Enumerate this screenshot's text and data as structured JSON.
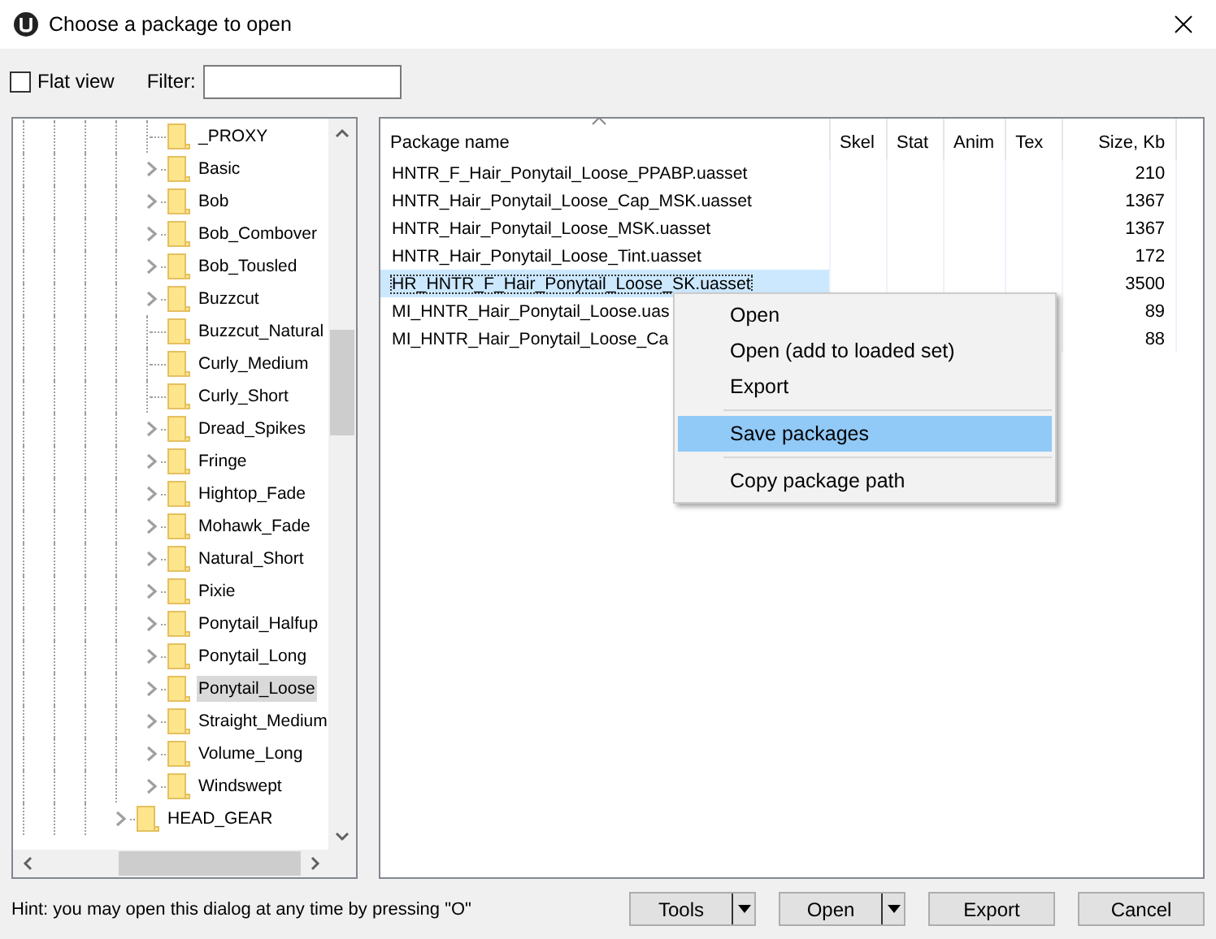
{
  "window": {
    "title": "Choose a package to open"
  },
  "toolbar": {
    "flat_view": {
      "label": "Flat view",
      "checked": false
    },
    "filter": {
      "label": "Filter:"
    }
  },
  "tree": {
    "items": [
      {
        "children": [
          {
            "label": "_PROXY",
            "expandable": false,
            "selected": false
          },
          {
            "label": "Basic",
            "expandable": true,
            "selected": false
          },
          {
            "label": "Bob",
            "expandable": true,
            "selected": false
          },
          {
            "label": "Bob_Combover",
            "expandable": true,
            "selected": false
          },
          {
            "label": "Bob_Tousled",
            "expandable": true,
            "selected": false
          },
          {
            "label": "Buzzcut",
            "expandable": true,
            "selected": false
          },
          {
            "label": "Buzzcut_Natural",
            "expandable": false,
            "selected": false
          },
          {
            "label": "Curly_Medium",
            "expandable": false,
            "selected": false
          },
          {
            "label": "Curly_Short",
            "expandable": false,
            "selected": false
          },
          {
            "label": "Dread_Spikes",
            "expandable": true,
            "selected": false
          },
          {
            "label": "Fringe",
            "expandable": true,
            "selected": false
          },
          {
            "label": "Hightop_Fade",
            "expandable": true,
            "selected": false
          },
          {
            "label": "Mohawk_Fade",
            "expandable": true,
            "selected": false
          },
          {
            "label": "Natural_Short",
            "expandable": true,
            "selected": false
          },
          {
            "label": "Pixie",
            "expandable": true,
            "selected": false
          },
          {
            "label": "Ponytail_Halfup",
            "expandable": true,
            "selected": false
          },
          {
            "label": "Ponytail_Long",
            "expandable": true,
            "selected": false
          },
          {
            "label": "Ponytail_Loose",
            "expandable": true,
            "selected": true
          },
          {
            "label": "Straight_Medium",
            "expandable": true,
            "selected": false
          },
          {
            "label": "Volume_Long",
            "expandable": true,
            "selected": false
          },
          {
            "label": "Windswept",
            "expandable": true,
            "selected": false
          }
        ]
      },
      {
        "label": "HEAD_GEAR",
        "expandable": true,
        "selected": false
      }
    ]
  },
  "list": {
    "columns": [
      {
        "label": "Package name",
        "sorted": true
      },
      {
        "label": "Skel",
        "sorted": false
      },
      {
        "label": "Stat",
        "sorted": false
      },
      {
        "label": "Anim",
        "sorted": false
      },
      {
        "label": "Tex",
        "sorted": false
      },
      {
        "label": "Size, Kb",
        "sorted": false
      }
    ],
    "rows": [
      {
        "name": "HNTR_F_Hair_Ponytail_Loose_PPABP.uasset",
        "size": "210",
        "selected": false
      },
      {
        "name": "HNTR_Hair_Ponytail_Loose_Cap_MSK.uasset",
        "size": "1367",
        "selected": false
      },
      {
        "name": "HNTR_Hair_Ponytail_Loose_MSK.uasset",
        "size": "1367",
        "selected": false
      },
      {
        "name": "HNTR_Hair_Ponytail_Loose_Tint.uasset",
        "size": "172",
        "selected": false
      },
      {
        "name": "HR_HNTR_F_Hair_Ponytail_Loose_SK.uasset",
        "size": "3500",
        "selected": true
      },
      {
        "name": "MI_HNTR_Hair_Ponytail_Loose.uas",
        "size": "89",
        "selected": false
      },
      {
        "name": "MI_HNTR_Hair_Ponytail_Loose_Ca",
        "size": "88",
        "selected": false
      }
    ]
  },
  "context_menu": {
    "items": [
      {
        "label": "Open",
        "selected": false,
        "separator_after": false
      },
      {
        "label": "Open (add to loaded set)",
        "selected": false,
        "separator_after": false
      },
      {
        "label": "Export",
        "selected": false,
        "separator_after": true
      },
      {
        "label": "Save packages",
        "selected": true,
        "separator_after": true
      },
      {
        "label": "Copy package path",
        "selected": false,
        "separator_after": false
      }
    ]
  },
  "status_bar": {
    "hint": "Hint: you may open this dialog at any time by pressing \"O\""
  },
  "buttons": [
    {
      "label": "Tools",
      "dropdown": true
    },
    {
      "label": "Open",
      "dropdown": true
    },
    {
      "label": "Export",
      "dropdown": false
    },
    {
      "label": "Cancel",
      "dropdown": false
    }
  ]
}
